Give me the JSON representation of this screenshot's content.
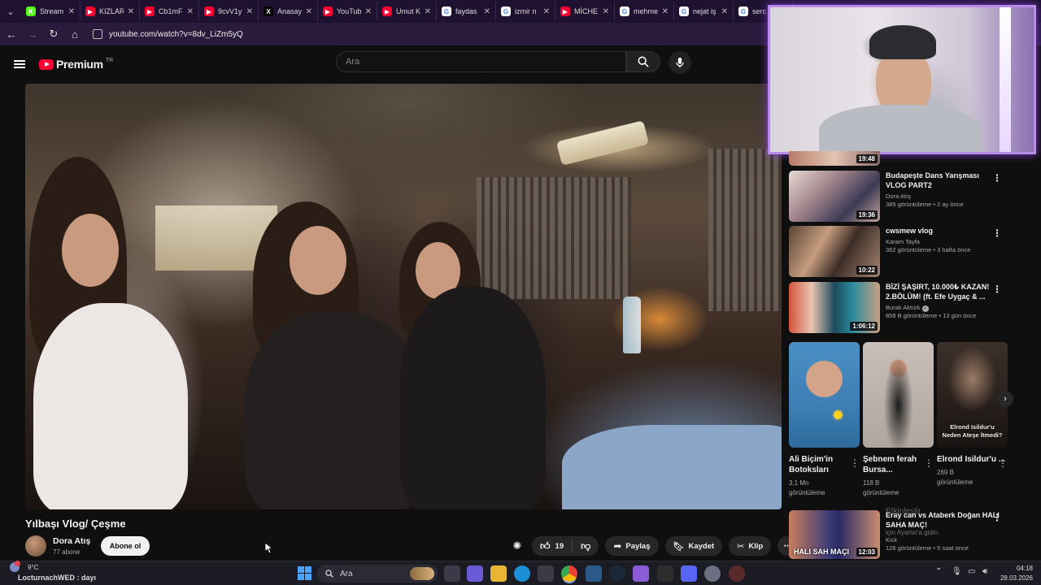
{
  "browser": {
    "tabs": [
      {
        "title": "Stream",
        "favicon_color": "#53fc18",
        "glyph": "K"
      },
      {
        "title": "KIZLAR",
        "favicon_color": "#ff0033",
        "glyph": "▶"
      },
      {
        "title": "Cb1mF",
        "favicon_color": "#ff0033",
        "glyph": "▶"
      },
      {
        "title": "9cvV1y",
        "favicon_color": "#ff0033",
        "glyph": "▶"
      },
      {
        "title": "Anasay",
        "favicon_color": "#000000",
        "glyph": "X"
      },
      {
        "title": "YouTub",
        "favicon_color": "#ff0033",
        "glyph": "▶"
      },
      {
        "title": "Umut K",
        "favicon_color": "#ff0033",
        "glyph": "▶"
      },
      {
        "title": "faydas",
        "favicon_color": "#ffffff",
        "glyph": "G"
      },
      {
        "title": "izmir n",
        "favicon_color": "#ffffff",
        "glyph": "G"
      },
      {
        "title": "MİCHE",
        "favicon_color": "#ff0033",
        "glyph": "▶"
      },
      {
        "title": "mehme",
        "favicon_color": "#ffffff",
        "glyph": "G"
      },
      {
        "title": "nejat iş",
        "favicon_color": "#ffffff",
        "glyph": "G"
      },
      {
        "title": "serc",
        "favicon_color": "#ffffff",
        "glyph": "G"
      }
    ],
    "url": "youtube.com/watch?v=8dv_LiZm5yQ"
  },
  "youtube": {
    "brand": "Premium",
    "country": "TR",
    "search_placeholder": "Ara"
  },
  "video": {
    "title": "Yılbaşı Vlog/ Çeşme",
    "channel": "Dora Atış",
    "subscribers": "77 abone",
    "subscribe_label": "Abone ol",
    "likes": "19",
    "share_label": "Paylaş",
    "save_label": "Kaydet",
    "clip_label": "Klip"
  },
  "sidebar": {
    "top_partial_duration": "19:48",
    "recommendations": [
      {
        "title": "Budapeşte Dans Yarışması VLOG PART2",
        "channel": "Dora Atış",
        "views": "385 görüntüleme",
        "age": "2 ay önce",
        "duration": "19:36"
      },
      {
        "title": "cwsmew vlog",
        "channel": "Karam Tayfa",
        "views": "362 görüntüleme",
        "age": "3 hafta önce",
        "duration": "10:22"
      },
      {
        "title": "BİZİ ŞAŞIRT, 10.000₺ KAZAN! 2.BÖLÜM! (ft. Efe Uygaç & ...",
        "channel": "Burak Aktürk",
        "views": "858 B görüntüleme",
        "age": "13 gün önce",
        "duration": "1:06:12"
      }
    ],
    "shorts": [
      {
        "title": "Ali Biçim'in Botoksları",
        "views": "3,1 Mn",
        "views_label": "görüntüleme"
      },
      {
        "title": "Şebnem ferah Bursa...",
        "views": "118 B",
        "views_label": "görüntüleme"
      },
      {
        "title": "Elrond Isildur'u ...",
        "views": "269 B",
        "views_label": "görüntüleme",
        "thumb_text": "Elrond Isildur'u Neden Ateşe İtmedi?"
      }
    ],
    "last": {
      "title": "Eray can vs Ataberk Doğan HALI SAHA MAÇ!",
      "channel": "Kick",
      "views": "126 görüntüleme",
      "age": "5 saat önce",
      "duration": "12:03",
      "overlay": "Etkinleştir",
      "overlay_sub": "için Ayarlar'a gidin.",
      "thumb_text": "HALI SAH MAÇI"
    }
  },
  "taskbar": {
    "weather": "9°C",
    "ticker": "LocturnachWED : dayı",
    "search": "Ara",
    "time": "04:18",
    "date": "28.03.2026"
  }
}
